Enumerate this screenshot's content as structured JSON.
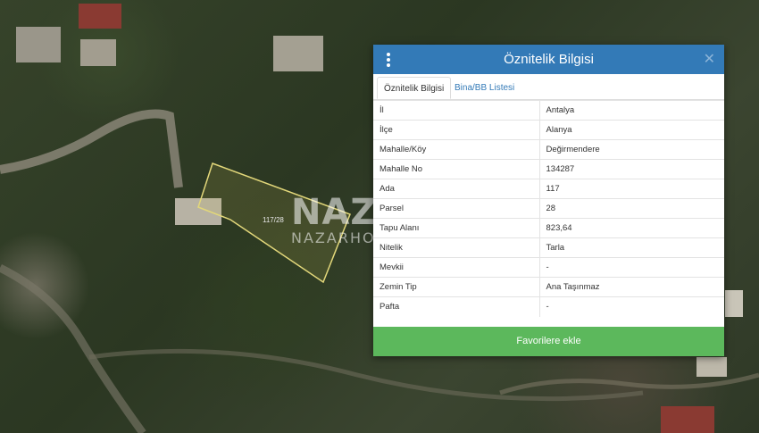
{
  "map": {
    "parcel_label": "117/28",
    "watermark_brand": "NAZAR",
    "watermark_sub": "NAZARHO"
  },
  "panel": {
    "title": "Öznitelik Bilgisi",
    "menu_icon": "more-vertical-icon",
    "close_icon": "close-icon",
    "header_color": "#337ab7",
    "tabs": [
      {
        "label": "Öznitelik Bilgisi",
        "active": true
      },
      {
        "label": "Bina/BB Listesi",
        "active": false
      }
    ],
    "rows": [
      {
        "key": "İl",
        "value": "Antalya"
      },
      {
        "key": "İlçe",
        "value": "Alanya"
      },
      {
        "key": "Mahalle/Köy",
        "value": "Değirmendere"
      },
      {
        "key": "Mahalle No",
        "value": "134287"
      },
      {
        "key": "Ada",
        "value": "117"
      },
      {
        "key": "Parsel",
        "value": "28"
      },
      {
        "key": "Tapu Alanı",
        "value": "823,64"
      },
      {
        "key": "Nitelik",
        "value": "Tarla"
      },
      {
        "key": "Mevkii",
        "value": "-"
      },
      {
        "key": "Zemin Tip",
        "value": "Ana Taşınmaz"
      },
      {
        "key": "Pafta",
        "value": "-"
      }
    ],
    "favorite_button": "Favorilere ekle",
    "favorite_color": "#5cb85c"
  }
}
